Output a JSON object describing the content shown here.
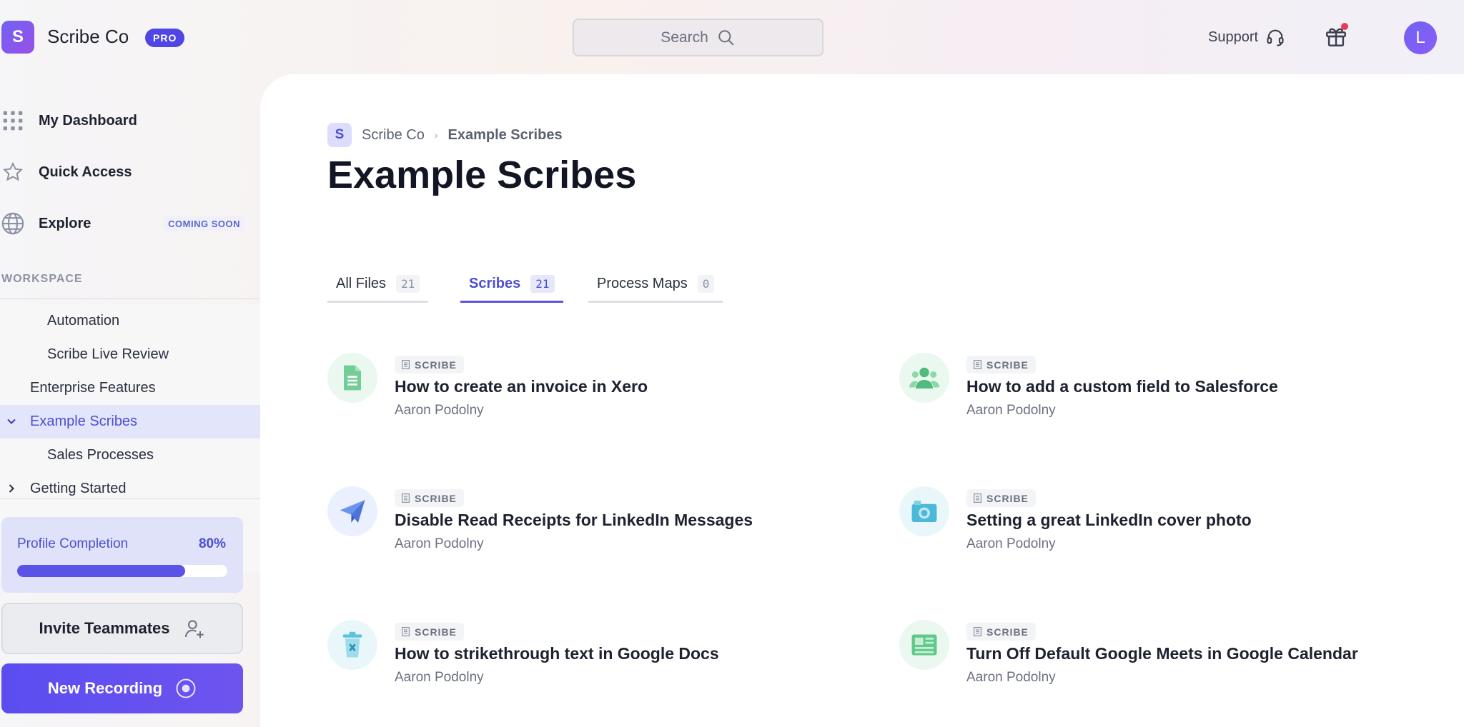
{
  "header": {
    "logo_letter": "S",
    "brand": "Scribe Co",
    "plan_badge": "PRO",
    "search_label": "Search",
    "support_label": "Support",
    "avatar_letter": "L"
  },
  "sidebar": {
    "nav": [
      {
        "label": "My Dashboard",
        "icon": "grid-icon"
      },
      {
        "label": "Quick Access",
        "icon": "star-icon"
      },
      {
        "label": "Explore",
        "icon": "globe-icon",
        "badge": "COMING SOON"
      }
    ],
    "workspace_title": "WORKSPACE",
    "tree": [
      {
        "label": "Automation",
        "level": 2
      },
      {
        "label": "Scribe Live Review",
        "level": 2
      },
      {
        "label": "Enterprise Features",
        "level": 1
      },
      {
        "label": "Example Scribes",
        "level": 1,
        "expanded": true,
        "active": true
      },
      {
        "label": "Sales Processes",
        "level": 2
      },
      {
        "label": "Getting Started",
        "level": 1,
        "expanded": false
      }
    ],
    "profile": {
      "label": "Profile Completion",
      "value": "80%",
      "progress": 0.8
    },
    "invite_label": "Invite Teammates",
    "new_recording_label": "New Recording"
  },
  "breadcrumb": {
    "logo_letter": "S",
    "org": "Scribe Co",
    "separator": "›",
    "current": "Example Scribes"
  },
  "page_title": "Example Scribes",
  "tabs": [
    {
      "label": "All Files",
      "count": "21",
      "active": false
    },
    {
      "label": "Scribes",
      "count": "21",
      "active": true
    },
    {
      "label": "Process Maps",
      "count": "0",
      "active": false
    }
  ],
  "scribes": [
    {
      "badge": "SCRIBE",
      "title": "How to create an invoice in Xero",
      "author": "Aaron Podolny",
      "icon": "document-icon"
    },
    {
      "badge": "SCRIBE",
      "title": "How to add a custom field to Salesforce",
      "author": "Aaron Podolny",
      "icon": "people-icon"
    },
    {
      "badge": "SCRIBE",
      "title": "Disable Read Receipts for LinkedIn Messages",
      "author": "Aaron Podolny",
      "icon": "paper-plane-icon"
    },
    {
      "badge": "SCRIBE",
      "title": "Setting a great LinkedIn cover photo",
      "author": "Aaron Podolny",
      "icon": "camera-icon"
    },
    {
      "badge": "SCRIBE",
      "title": "How to strikethrough text in Google Docs",
      "author": "Aaron Podolny",
      "icon": "trash-icon"
    },
    {
      "badge": "SCRIBE",
      "title": "Turn Off Default Google Meets in Google Calendar",
      "author": "Aaron Podolny",
      "icon": "newspaper-icon"
    }
  ],
  "colors": {
    "accent": "#5b52e8",
    "active_bg": "#e3e5fb",
    "notification": "#e73b5b"
  }
}
